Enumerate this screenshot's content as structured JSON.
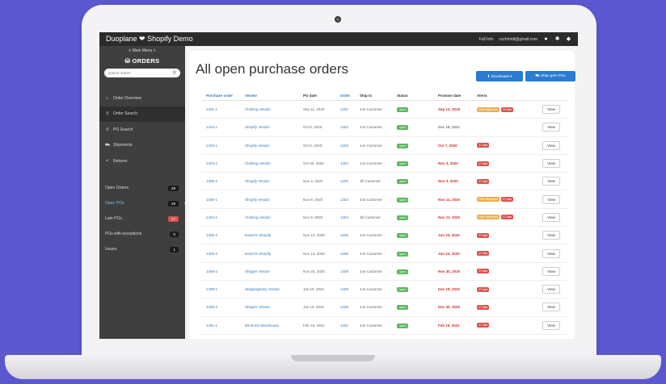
{
  "app": {
    "title": "Duoplane ❤ Shopify Demo",
    "user_email": "cschmidt@gmail.com",
    "user_prefix": "Full Info"
  },
  "sidebar": {
    "main_menu": "≡ Main Menu >",
    "section": "ORDERS",
    "search_placeholder": "search orders",
    "nav": [
      {
        "label": "Order Overview",
        "icon": "home-icon",
        "glyph": "⌂"
      },
      {
        "label": "Order Search",
        "icon": "search-icon",
        "glyph": "⚲"
      },
      {
        "label": "PO Search",
        "icon": "search-icon",
        "glyph": "⚲"
      },
      {
        "label": "Shipments",
        "icon": "truck-icon",
        "glyph": "⛟"
      },
      {
        "label": "Returns",
        "icon": "return-icon",
        "glyph": "↶"
      }
    ],
    "filters": [
      {
        "label": "Open Orders",
        "count": "29"
      },
      {
        "label": "Open POs",
        "count": "29"
      },
      {
        "label": "Late POs",
        "count": "17"
      },
      {
        "label": "POs with exceptions",
        "count": "0"
      },
      {
        "label": "Issues",
        "count": "1"
      }
    ]
  },
  "page": {
    "title": "All open purchase orders",
    "download_label": "⬇ Downloads ▾",
    "ship_label": "⛟ Ship open POs"
  },
  "table": {
    "headers": [
      "Purchase order",
      "Vendor",
      "PO date",
      "Order",
      "Ship to",
      "Status",
      "Promise date",
      "Alerts",
      ""
    ],
    "rows": [
      {
        "po": "1401-1",
        "vendor": "Clothing Vendor",
        "date": "Sep 11, 2019",
        "order": "1401",
        "ship": "Joe Customer",
        "status": "open",
        "promise": "Sep 13, 2019",
        "alerts": [
          "Late shipment",
          "19 late"
        ],
        "view": "View"
      },
      {
        "po": "1402-1",
        "vendor": "Shopify Vendor",
        "date": "Oct 5, 2020",
        "order": "1402",
        "ship": "Joe Customer",
        "status": "open",
        "promise": "Dec 18, 2021",
        "alerts": [],
        "view": "View"
      },
      {
        "po": "1403-1",
        "vendor": "Shopify Vendor",
        "date": "Oct 5, 2020",
        "order": "1403",
        "ship": "Joe Customer",
        "status": "open",
        "promise": "Oct 7, 2020",
        "alerts": [
          "17 late"
        ],
        "view": "View"
      },
      {
        "po": "1404-2",
        "vendor": "Clothing Vendor",
        "date": "Oct 30, 2020",
        "order": "1404",
        "ship": "Joe Customer",
        "status": "open",
        "promise": "Nov 3, 2020",
        "alerts": [
          "17 late"
        ],
        "view": "View"
      },
      {
        "po": "1405-2",
        "vendor": "Shopify Vendor",
        "date": "Nov 3, 2020",
        "order": "1405",
        "ship": "Jill Customer",
        "status": "open",
        "promise": "Nov 3, 2020",
        "alerts": [
          "17 late"
        ],
        "view": "View"
      },
      {
        "po": "1405-1",
        "vendor": "Shopify Vendor",
        "date": "Nov 9, 2020",
        "order": "1403",
        "ship": "Joe Customer",
        "status": "open",
        "promise": "Nov 11, 2020",
        "alerts": [
          "Late shipment",
          "17 late"
        ],
        "view": "View"
      },
      {
        "po": "1404-1",
        "vendor": "Clothing Vendor",
        "date": "Nov 9, 2020",
        "order": "1404",
        "ship": "Jill Customer",
        "status": "open",
        "promise": "Nov 11, 2020",
        "alerts": [
          "Late shipment",
          "17 late"
        ],
        "view": "View"
      },
      {
        "po": "1405-2",
        "vendor": "Daniel's Shopify",
        "date": "Nov 13, 2020",
        "order": "1405",
        "ship": "Joe Customer",
        "status": "open",
        "promise": "Jun 23, 2020",
        "alerts": [
          "17 late"
        ],
        "view": "View"
      },
      {
        "po": "1406-2",
        "vendor": "Daniel's Shopify",
        "date": "Nov 13, 2020",
        "order": "1406",
        "ship": "Joe Customer",
        "status": "open",
        "promise": "Jun 24, 2020",
        "alerts": [
          "17 late"
        ],
        "view": "View"
      },
      {
        "po": "1408-2",
        "vendor": "Shipper Vendor",
        "date": "Nov 26, 2020",
        "order": "1408",
        "ship": "Joe Customer",
        "status": "open",
        "promise": "Nov 30, 2020",
        "alerts": [
          "17 late"
        ],
        "view": "View"
      },
      {
        "po": "1409-1",
        "vendor": "ShippingEasy Vendor",
        "date": "Jan 10, 2021",
        "order": "1409",
        "ship": "Joe Customer",
        "status": "open",
        "promise": "Dec 18, 2020",
        "alerts": [
          "17 late"
        ],
        "view": "View"
      },
      {
        "po": "1409-4",
        "vendor": "Shipper Vendor",
        "date": "Jan 10, 2021",
        "order": "1409",
        "ship": "Joe Customer",
        "status": "open",
        "promise": "Dec 30, 2020",
        "alerts": [
          "17 late"
        ],
        "view": "View"
      },
      {
        "po": "1451-1",
        "vendor": "Elmhurst Warehouse",
        "date": "Feb 18, 2021",
        "order": "1451",
        "ship": "Joe Customer",
        "status": "open",
        "promise": "Feb 19, 2021",
        "alerts": [
          "17 late"
        ],
        "view": "View"
      }
    ]
  },
  "colors": {
    "accent": "#2a7bd1",
    "late": "#d9534f",
    "open": "#5cb85c",
    "warning": "#f0ad4e",
    "background": "#5b57d0"
  }
}
